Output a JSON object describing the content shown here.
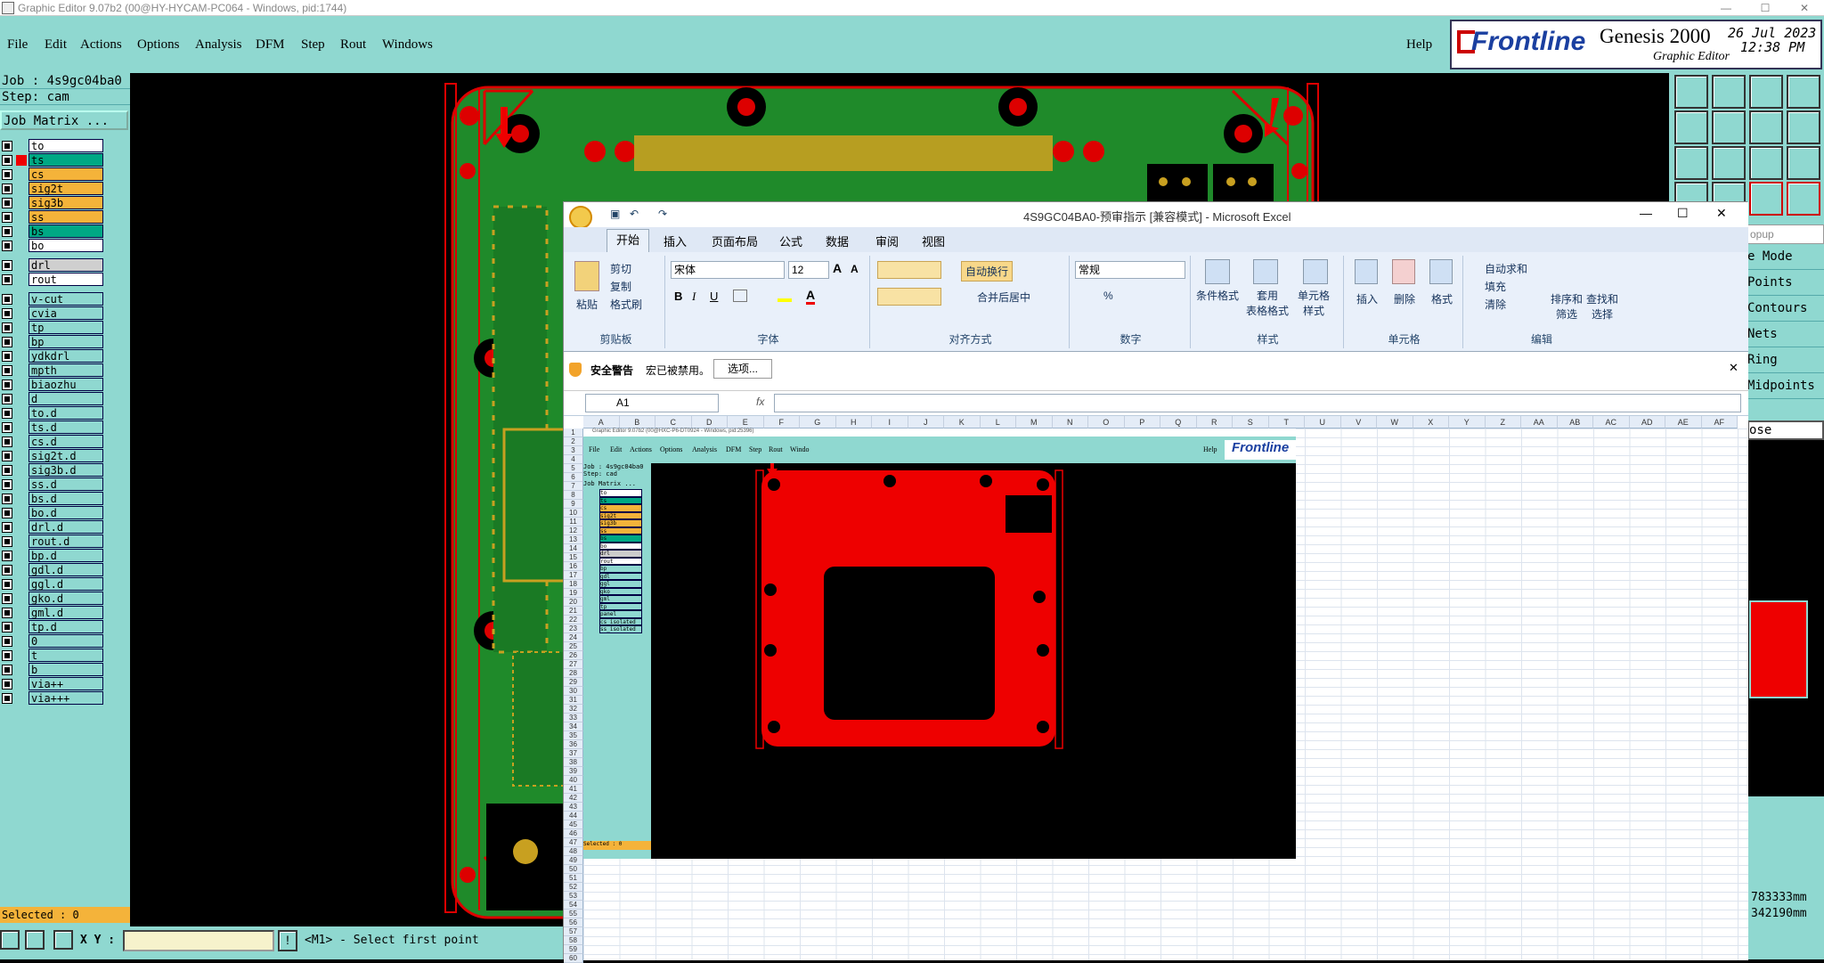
{
  "genesis": {
    "title": "Graphic Editor 9.07b2 (00@HY-HYCAM-PC064 - Windows, pid:1744)",
    "menu": [
      "File",
      "Edit",
      "Actions",
      "Options",
      "Analysis",
      "DFM",
      "Step",
      "Rout",
      "Windows"
    ],
    "help": "Help",
    "brand": "Frontline",
    "product": "Genesis 2000",
    "subtitle": "Graphic Editor",
    "date": "26 Jul 2023",
    "time": "12:38 PM",
    "job": "Job : 4s9gc04ba0",
    "step": "Step: cam",
    "matrix_btn": "Job Matrix ...",
    "layers": [
      {
        "name": "to",
        "color": "#ffffff"
      },
      {
        "name": "ts",
        "color": "#00a884",
        "sel": true
      },
      {
        "name": "cs",
        "color": "#f4b33a"
      },
      {
        "name": "sig2t",
        "color": "#f4b33a"
      },
      {
        "name": "sig3b",
        "color": "#f4b33a"
      },
      {
        "name": "ss",
        "color": "#f4b33a"
      },
      {
        "name": "bs",
        "color": "#00a884"
      },
      {
        "name": "bo",
        "color": "#ffffff"
      },
      {
        "name": "drl",
        "color": "#cfcfcf",
        "gap": true
      },
      {
        "name": "rout",
        "color": "#ffffff"
      },
      {
        "name": "v-cut",
        "color": "#8fd8d0",
        "gap": true
      },
      {
        "name": "cvia",
        "color": "#8fd8d0"
      },
      {
        "name": "tp",
        "color": "#8fd8d0"
      },
      {
        "name": "bp",
        "color": "#8fd8d0"
      },
      {
        "name": "ydkdrl",
        "color": "#8fd8d0"
      },
      {
        "name": "mpth",
        "color": "#8fd8d0"
      },
      {
        "name": "biaozhu",
        "color": "#8fd8d0"
      },
      {
        "name": "d",
        "color": "#8fd8d0"
      },
      {
        "name": "to.d",
        "color": "#8fd8d0"
      },
      {
        "name": "ts.d",
        "color": "#8fd8d0"
      },
      {
        "name": "cs.d",
        "color": "#8fd8d0"
      },
      {
        "name": "sig2t.d",
        "color": "#8fd8d0"
      },
      {
        "name": "sig3b.d",
        "color": "#8fd8d0"
      },
      {
        "name": "ss.d",
        "color": "#8fd8d0"
      },
      {
        "name": "bs.d",
        "color": "#8fd8d0"
      },
      {
        "name": "bo.d",
        "color": "#8fd8d0"
      },
      {
        "name": "drl.d",
        "color": "#8fd8d0"
      },
      {
        "name": "rout.d",
        "color": "#8fd8d0"
      },
      {
        "name": "bp.d",
        "color": "#8fd8d0"
      },
      {
        "name": "gdl.d",
        "color": "#8fd8d0"
      },
      {
        "name": "ggl.d",
        "color": "#8fd8d0"
      },
      {
        "name": "gko.d",
        "color": "#8fd8d0"
      },
      {
        "name": "gml.d",
        "color": "#8fd8d0"
      },
      {
        "name": "tp.d",
        "color": "#8fd8d0"
      },
      {
        "name": "0",
        "color": "#8fd8d0"
      },
      {
        "name": "t",
        "color": "#8fd8d0"
      },
      {
        "name": "b",
        "color": "#8fd8d0"
      },
      {
        "name": "via++",
        "color": "#8fd8d0"
      },
      {
        "name": "via+++",
        "color": "#8fd8d0"
      }
    ],
    "selected": "Selected : 0",
    "xy_label": "X Y :",
    "prompt": "<M1> - Select first point",
    "right_items": [
      "e Mode",
      "Points",
      "Contours",
      "Nets",
      "Ring",
      "Midpoints"
    ],
    "right_popup": "opup",
    "right_close": "ose",
    "coord1": "783333mm",
    "coord2": "342190mm",
    "units": "MM"
  },
  "excel": {
    "title": "4S9GC04BA0-预审指示  [兼容模式] - Microsoft Excel",
    "tabs": [
      "开始",
      "插入",
      "页面布局",
      "公式",
      "数据",
      "审阅",
      "视图"
    ],
    "clipboard": {
      "paste": "粘贴",
      "cut": "剪切",
      "copy": "复制",
      "fmt": "格式刷",
      "group": "剪贴板"
    },
    "font": {
      "name": "宋体",
      "size": "12",
      "group": "字体",
      "bold": "B",
      "italic": "I",
      "underline": "U"
    },
    "align": {
      "wrap": "自动换行",
      "merge": "合并后居中",
      "group": "对齐方式"
    },
    "number": {
      "fmt": "常规",
      "group": "数字",
      "pct": "%"
    },
    "styles": {
      "cond": "条件格式",
      "table": "套用\n表格格式",
      "cell": "单元格\n样式",
      "group": "样式"
    },
    "cells": {
      "insert": "插入",
      "delete": "删除",
      "format": "格式",
      "group": "单元格"
    },
    "edit": {
      "autosum": "自动求和",
      "fill": "填充",
      "clear": "清除",
      "sort": "排序和\n筛选",
      "find": "查找和\n选择",
      "group": "编辑"
    },
    "security": {
      "title": "安全警告",
      "msg": "宏已被禁用。",
      "btn": "选项..."
    },
    "namebox": "A1",
    "fx": "fx",
    "columns": [
      "A",
      "B",
      "C",
      "D",
      "E",
      "F",
      "G",
      "H",
      "I",
      "J",
      "K",
      "L",
      "M",
      "N",
      "O",
      "P",
      "Q",
      "R",
      "S",
      "T",
      "U",
      "V",
      "W",
      "X",
      "Y",
      "Z",
      "AA",
      "AB",
      "AC",
      "AD",
      "AE",
      "AF"
    ]
  },
  "embedded": {
    "title": "Graphic Editor 9.07b2 (00@HXC-P6-DT0924 - Windows, pid:25396)",
    "menu": [
      "File",
      "Edit",
      "Actions",
      "Options",
      "Analysis",
      "DFM",
      "Step",
      "Rout",
      "Windo"
    ],
    "help": "Help",
    "brand": "Frontline",
    "job": "Job : 4s9gc04ba0",
    "step": "Step: cad",
    "matrix": "Job Matrix ...",
    "layers": [
      "to",
      "ts",
      "cs",
      "sig2t",
      "sig3b",
      "ss",
      "bs",
      "bo",
      "drl",
      "rout",
      "bp",
      "gdl",
      "ggl",
      "gko",
      "gml",
      "tp",
      "panel",
      "cs_isolated",
      "ss_isolated"
    ],
    "selected": "Selected : 0"
  }
}
